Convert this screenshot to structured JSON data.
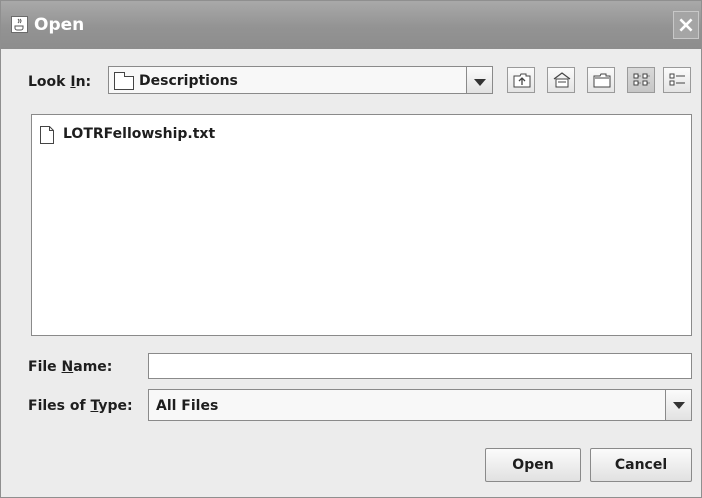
{
  "window": {
    "title": "Open",
    "icon": "java-cup-icon",
    "close_icon": "close-icon"
  },
  "look_in": {
    "label_prefix": "Look ",
    "label_mnemonic": "I",
    "label_suffix": "n:",
    "value": "Descriptions",
    "icon": "folder-icon"
  },
  "toolbar": {
    "buttons": [
      {
        "name": "up-one-level-button",
        "icon": "folder-up-icon"
      },
      {
        "name": "home-button",
        "icon": "home-icon"
      },
      {
        "name": "new-folder-button",
        "icon": "new-folder-icon"
      },
      {
        "name": "list-view-button",
        "icon": "list-view-icon",
        "pressed": true
      },
      {
        "name": "details-view-button",
        "icon": "details-view-icon",
        "pressed": false
      }
    ]
  },
  "file_list": {
    "items": [
      {
        "name": "LOTRFellowship.txt",
        "icon": "document-icon"
      }
    ]
  },
  "file_name": {
    "label_prefix": "File ",
    "label_mnemonic": "N",
    "label_suffix": "ame:",
    "value": "",
    "placeholder": ""
  },
  "files_of_type": {
    "label_prefix": "Files of ",
    "label_mnemonic": "T",
    "label_suffix": "ype:",
    "value": "All Files"
  },
  "buttons": {
    "open_label": "Open",
    "cancel_label": "Cancel"
  },
  "colors": {
    "titlebar": "#939393",
    "window_bg": "#ececec",
    "panel_bg": "#ffffff"
  }
}
